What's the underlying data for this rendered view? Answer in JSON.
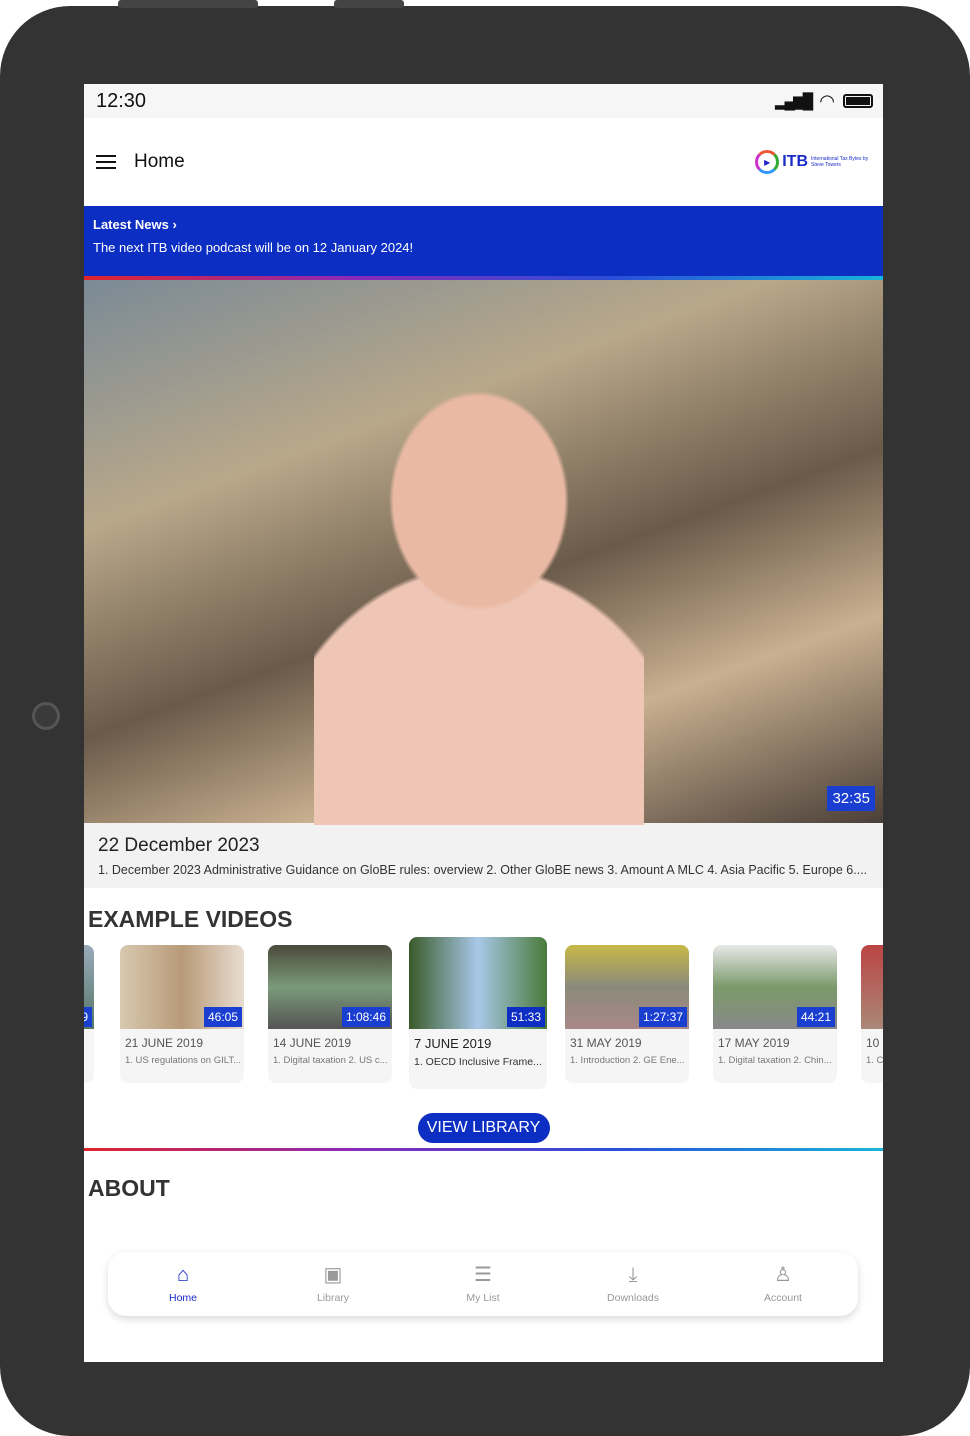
{
  "status": {
    "time": "12:30"
  },
  "header": {
    "title": "Home",
    "logo_text": "ITB",
    "logo_sub": "International Tax Bytes by Steve Towers"
  },
  "news": {
    "title": "Latest News ›",
    "message": "The next ITB video podcast will be on 12 January 2024!"
  },
  "featured": {
    "duration": "32:35",
    "date": "22 December 2023",
    "summary": "1. December 2023 Administrative Guidance on GloBE rules: overview 2. Other GloBE news 3. Amount A MLC 4. Asia Pacific 5. Europe 6...."
  },
  "example_videos": {
    "heading": "EXAMPLE VIDEOS",
    "items": [
      {
        "duration": "9",
        "date": "",
        "summary": ""
      },
      {
        "duration": "46:05",
        "date": "21 JUNE 2019",
        "summary": "1. US regulations on GILT..."
      },
      {
        "duration": "1:08:46",
        "date": "14 JUNE 2019",
        "summary": "1. Digital taxation 2. US c..."
      },
      {
        "duration": "51:33",
        "date": "7 JUNE 2019",
        "summary": "1. OECD Inclusive Frame..."
      },
      {
        "duration": "1:27:37",
        "date": "31 MAY 2019",
        "summary": "1. Introduction 2. GE Ene..."
      },
      {
        "duration": "44:21",
        "date": "17 MAY 2019",
        "summary": "1. Digital taxation 2. Chin..."
      },
      {
        "duration": "",
        "date": "10 M",
        "summary": "1. Cl"
      }
    ],
    "button": "VIEW LIBRARY"
  },
  "about": {
    "heading": "ABOUT"
  },
  "nav": [
    {
      "label": "Home",
      "icon": "home-icon"
    },
    {
      "label": "Library",
      "icon": "library-icon"
    },
    {
      "label": "My List",
      "icon": "list-icon"
    },
    {
      "label": "Downloads",
      "icon": "download-icon"
    },
    {
      "label": "Account",
      "icon": "account-icon"
    }
  ],
  "colors": {
    "accent": "#0c2ec2"
  }
}
